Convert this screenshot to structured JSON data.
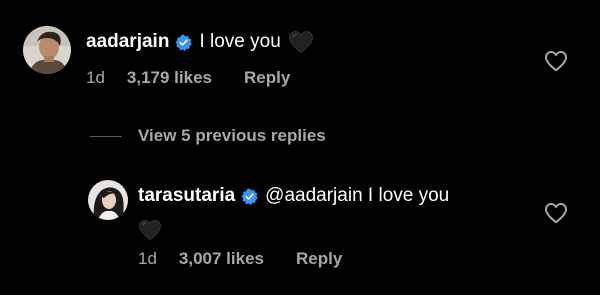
{
  "colors": {
    "background": "#000000",
    "text_primary": "#ffffff",
    "text_secondary": "#a8a8a8",
    "verified_badge": "#3797f0",
    "divider": "#5a5a5a"
  },
  "comments": [
    {
      "username": "aadarjain",
      "verified": true,
      "text": "I love you",
      "emoji": "black-heart",
      "time": "1d",
      "likes": "3,179 likes",
      "reply_label": "Reply",
      "avatar_icon": "avatar-aadarjain",
      "like_icon": "heart-outline-icon"
    }
  ],
  "view_replies": {
    "label": "View 5 previous replies"
  },
  "replies": [
    {
      "username": "tarasutaria",
      "verified": true,
      "text": "@aadarjain I love you",
      "emoji": "black-heart",
      "time": "1d",
      "likes": "3,007 likes",
      "reply_label": "Reply",
      "avatar_icon": "avatar-tarasutaria",
      "like_icon": "heart-outline-icon"
    }
  ]
}
